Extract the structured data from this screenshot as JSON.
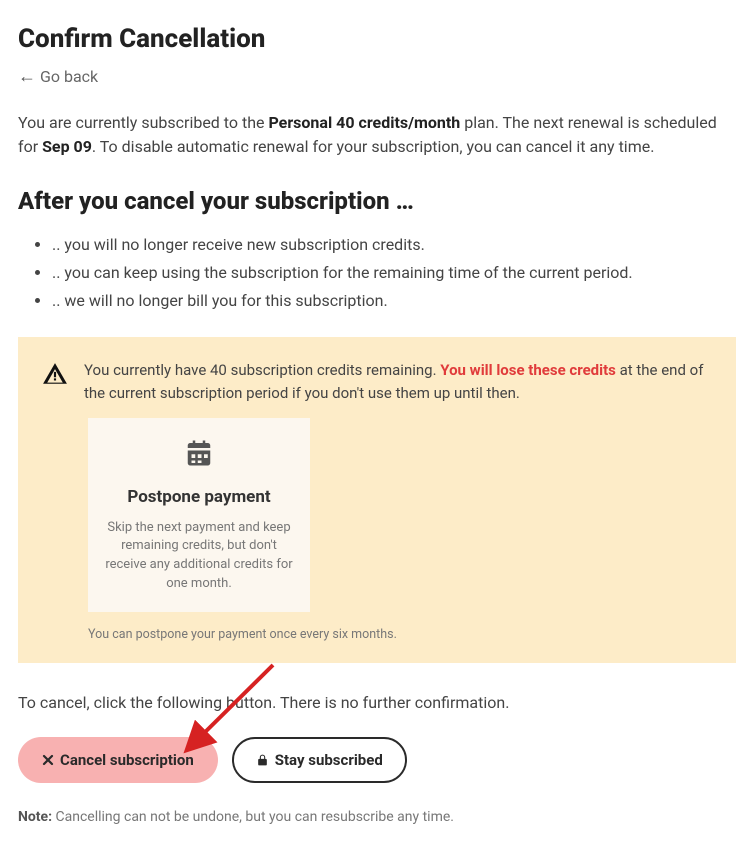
{
  "title": "Confirm Cancellation",
  "go_back": "Go back",
  "intro": {
    "pre_plan": "You are currently subscribed to the ",
    "plan": "Personal 40 credits/month",
    "post_plan": " plan. The next renewal is scheduled for ",
    "date": "Sep 09",
    "post_date": ". To disable automatic renewal for your subscription, you can cancel it any time."
  },
  "section_heading": "After you cancel your subscription …",
  "bullets": [
    ".. you will no longer receive new subscription credits.",
    ".. you can keep using the subscription for the remaining time of the current period.",
    ".. we will no longer bill you for this subscription."
  ],
  "notice": {
    "pre": "You currently have 40 subscription credits remaining. ",
    "danger": "You will lose these credits",
    "post": " at the end of the current subscription period if you don't use them up until then."
  },
  "postpone": {
    "title": "Postpone payment",
    "desc": "Skip the next payment and keep remaining credits, but don't receive any additional credits for one month.",
    "note": "You can postpone your payment once every six months."
  },
  "cancel_instruction": "To cancel, click the following button. There is no further confirmation.",
  "buttons": {
    "cancel": "Cancel subscription",
    "stay": "Stay subscribed"
  },
  "footer": {
    "label": "Note:",
    "text": " Cancelling can not be undone, but you can resubscribe any time."
  }
}
